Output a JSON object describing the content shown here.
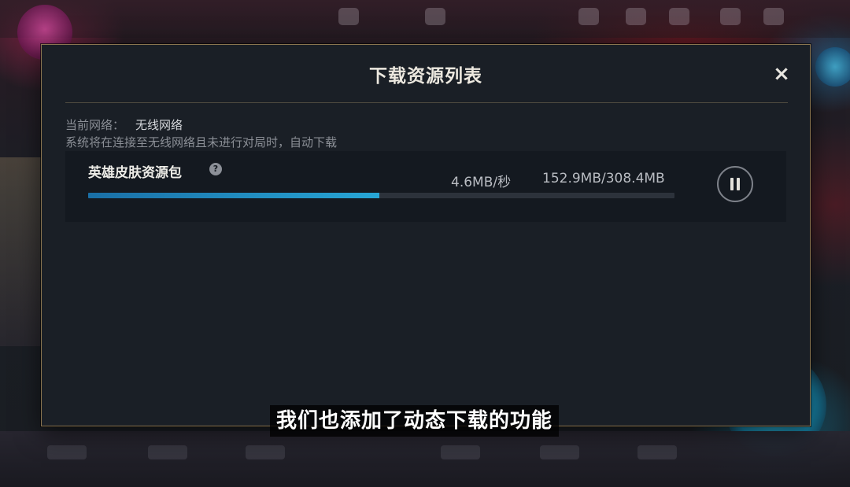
{
  "dialog": {
    "title": "下载资源列表",
    "close_icon": "×"
  },
  "network": {
    "label": "当前网络：",
    "value": "无线网络",
    "description": "系统将在连接至无线网络且未进行对局时，自动下载"
  },
  "downloads": [
    {
      "name": "英雄皮肤资源包",
      "help_icon": "?",
      "speed": "4.6MB/秒",
      "size": "152.9MB/308.4MB",
      "progress": 0.496,
      "state": "downloading"
    }
  ],
  "subtitle": "我们也添加了动态下载的功能",
  "colors": {
    "progress_fill": "#27a6d6",
    "dialog_border": "#8a7550",
    "dialog_bg": "#1a1f26"
  }
}
